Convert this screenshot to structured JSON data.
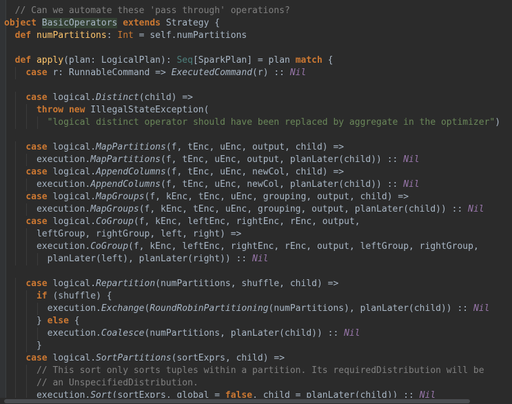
{
  "editor": {
    "language": "scala",
    "lines": [
      "  // Can we automate these 'pass through' operations?",
      "object BasicOperators extends Strategy {",
      "  def numPartitions: Int = self.numPartitions",
      "",
      "  def apply(plan: LogicalPlan): Seq[SparkPlan] = plan match {",
      "    case r: RunnableCommand => ExecutedCommand(r) :: Nil",
      "",
      "    case logical.Distinct(child) =>",
      "      throw new IllegalStateException(",
      "        \"logical distinct operator should have been replaced by aggregate in the optimizer\")",
      "",
      "    case logical.MapPartitions(f, tEnc, uEnc, output, child) =>",
      "      execution.MapPartitions(f, tEnc, uEnc, output, planLater(child)) :: Nil",
      "    case logical.AppendColumns(f, tEnc, uEnc, newCol, child) =>",
      "      execution.AppendColumns(f, tEnc, uEnc, newCol, planLater(child)) :: Nil",
      "    case logical.MapGroups(f, kEnc, tEnc, uEnc, grouping, output, child) =>",
      "      execution.MapGroups(f, kEnc, tEnc, uEnc, grouping, output, planLater(child)) :: Nil",
      "    case logical.CoGroup(f, kEnc, leftEnc, rightEnc, rEnc, output,",
      "      leftGroup, rightGroup, left, right) =>",
      "      execution.CoGroup(f, kEnc, leftEnc, rightEnc, rEnc, output, leftGroup, rightGroup,",
      "        planLater(left), planLater(right)) :: Nil",
      "",
      "    case logical.Repartition(numPartitions, shuffle, child) =>",
      "      if (shuffle) {",
      "        execution.Exchange(RoundRobinPartitioning(numPartitions), planLater(child)) :: Nil",
      "      } else {",
      "        execution.Coalesce(numPartitions, planLater(child)) :: Nil",
      "      }",
      "    case logical.SortPartitions(sortExprs, child) =>",
      "      // This sort only sorts tuples within a partition. Its requiredDistribution will be",
      "      // an UnspecifiedDistribution.",
      "      execution.Sort(sortExprs, global = false, child = planLater(child)) :: Nil"
    ]
  }
}
